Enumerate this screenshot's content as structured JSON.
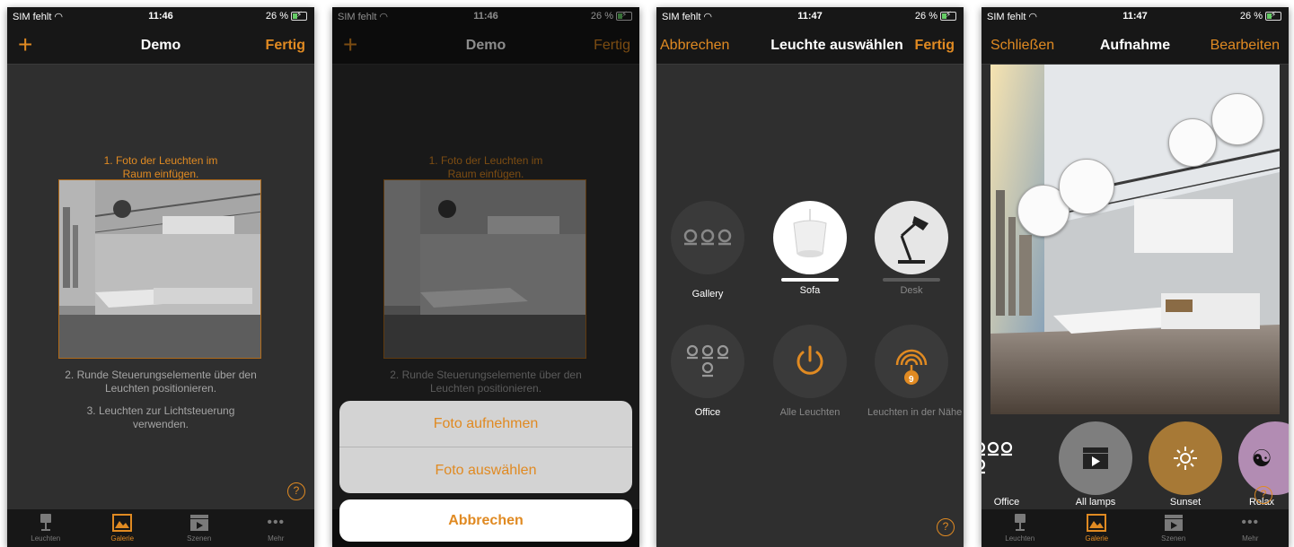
{
  "status": {
    "carrier": "SIM fehlt",
    "battery": "26 %"
  },
  "tabs": [
    {
      "label": "Leuchten",
      "icon": "lamp-icon"
    },
    {
      "label": "Galerie",
      "icon": "gallery-icon"
    },
    {
      "label": "Szenen",
      "icon": "scene-clapper-icon"
    },
    {
      "label": "Mehr",
      "icon": "more-dots-icon"
    }
  ],
  "screen1": {
    "time": "11:46",
    "title": "Demo",
    "add": "+",
    "done": "Fertig",
    "step1": "1. Foto der Leuchten im Raum einfügen.",
    "step2": "2. Runde Steuerungselemente über den Leuchten positionieren.",
    "step3": "3. Leuchten zur Lichtsteuerung verwenden.",
    "help": "?"
  },
  "screen2": {
    "time": "11:46",
    "title": "Demo",
    "add": "+",
    "done": "Fertig",
    "step1": "1. Foto der Leuchten im Raum einfügen.",
    "step2": "2. Runde Steuerungselemente über den Leuchten positionieren.",
    "sheet_take": "Foto aufnehmen",
    "sheet_choose": "Foto auswählen",
    "sheet_cancel": "Abbrechen"
  },
  "screen3": {
    "time": "11:47",
    "cancel": "Abbrechen",
    "title": "Leuchte auswählen",
    "done": "Fertig",
    "lamps": [
      {
        "label": "Gallery",
        "icon": "three-bulbs-icon"
      },
      {
        "label": "Sofa",
        "icon": "pendant-lamp-icon"
      },
      {
        "label": "Desk",
        "icon": "desk-lamp-icon"
      },
      {
        "label": "Office",
        "icon": "bulb-group-icon"
      },
      {
        "label": "Alle Leuchten",
        "icon": "power-icon"
      },
      {
        "label": "Leuchten in der Nähe",
        "icon": "nearby-signal-icon",
        "badge": "9"
      }
    ],
    "help": "?"
  },
  "screen4": {
    "time": "11:47",
    "close": "Schließen",
    "title": "Aufnahme",
    "edit": "Bearbeiten",
    "scenes": [
      {
        "label": "Office",
        "icon": "bulb-group-icon"
      },
      {
        "label": "All lamps",
        "icon": "scene-clapper-icon"
      },
      {
        "label": "Sunset",
        "icon": "sun-icon"
      },
      {
        "label": "Relax",
        "icon": "yin-yang-icon"
      }
    ],
    "help": "?"
  },
  "colors": {
    "accent": "#e08a22",
    "bar": "#171717",
    "background": "#2f2f2f"
  }
}
